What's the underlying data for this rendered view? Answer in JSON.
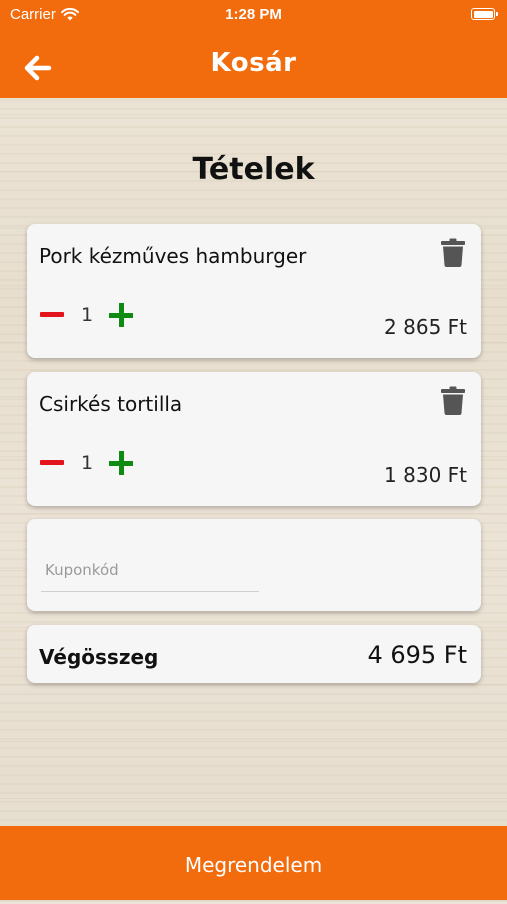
{
  "status_bar": {
    "carrier": "Carrier",
    "time": "1:28 PM"
  },
  "nav": {
    "title": "Kosár",
    "back_icon": "arrow-left-icon"
  },
  "section_title": "Tételek",
  "cart_items": [
    {
      "name": "Pork kézműves hamburger",
      "quantity": "1",
      "price": "2 865 Ft"
    },
    {
      "name": "Csirkés tortilla",
      "quantity": "1",
      "price": "1 830 Ft"
    }
  ],
  "coupon": {
    "placeholder": "Kuponkód",
    "value": ""
  },
  "total": {
    "label": "Végösszeg",
    "value": "4 695 Ft"
  },
  "footer": {
    "order_label": "Megrendelem"
  },
  "colors": {
    "brand": "#f26c0d",
    "minus": "#e3141b",
    "plus": "#0f8a12"
  }
}
